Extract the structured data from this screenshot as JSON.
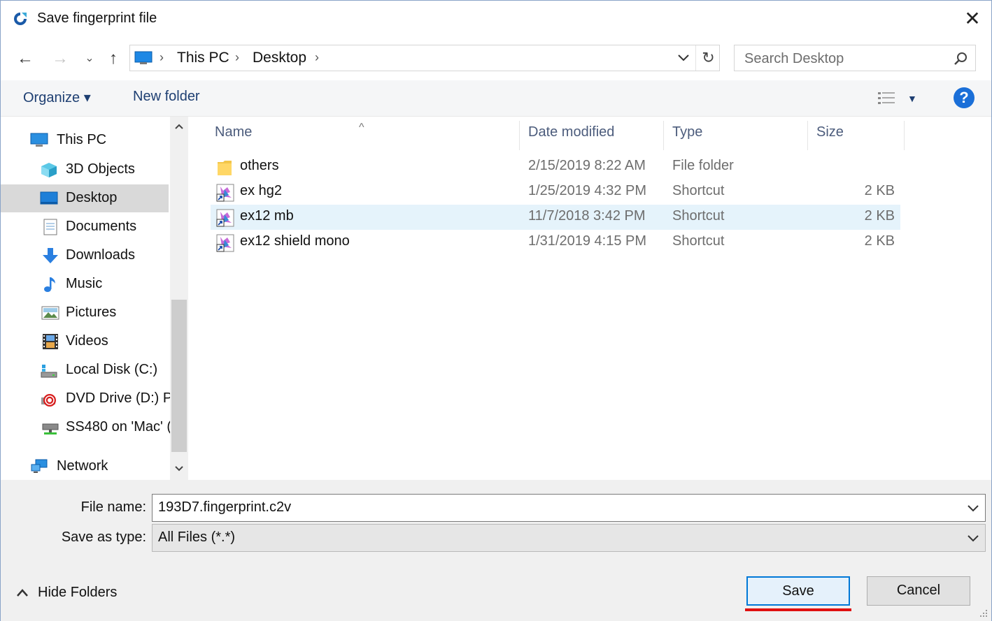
{
  "window": {
    "title": "Save fingerprint file",
    "close_label": "✕"
  },
  "nav": {
    "back_glyph": "←",
    "forward_glyph": "→",
    "recent_glyph": "⌄",
    "up_glyph": "↑",
    "breadcrumb": [
      "This PC",
      "Desktop"
    ],
    "separator": "›",
    "dropdown_glyph": "⌄",
    "refresh_glyph": "↻"
  },
  "search": {
    "placeholder": "Search Desktop"
  },
  "commands": {
    "organize": "Organize ▾",
    "new_folder": "New folder",
    "view_dropdown": "▼",
    "help": "?"
  },
  "sidebar": {
    "items": [
      {
        "label": "This PC",
        "icon": "computer-icon"
      },
      {
        "label": "3D Objects",
        "icon": "cube-icon"
      },
      {
        "label": "Desktop",
        "icon": "desktop-icon",
        "selected": true
      },
      {
        "label": "Documents",
        "icon": "document-icon"
      },
      {
        "label": "Downloads",
        "icon": "download-arrow-icon"
      },
      {
        "label": "Music",
        "icon": "music-note-icon"
      },
      {
        "label": "Pictures",
        "icon": "picture-icon"
      },
      {
        "label": "Videos",
        "icon": "film-icon"
      },
      {
        "label": "Local Disk (C:)",
        "icon": "drive-icon"
      },
      {
        "label": "DVD Drive (D:) P.",
        "icon": "dvd-icon"
      },
      {
        "label": "SS480 on 'Mac' (",
        "icon": "network-drive-icon"
      },
      {
        "label": "Network",
        "icon": "network-icon"
      }
    ],
    "scroll_up": "⌃",
    "scroll_down": "⌄"
  },
  "filelist": {
    "columns": [
      "Name",
      "Date modified",
      "Type",
      "Size"
    ],
    "sort_glyph": "^",
    "rows": [
      {
        "name": "others",
        "date": "2/15/2019 8:22 AM",
        "type": "File folder",
        "size": "",
        "icon": "folder-icon"
      },
      {
        "name": "ex hg2",
        "date": "1/25/2019 4:32 PM",
        "type": "Shortcut",
        "size": "2 KB",
        "icon": "shortcut-icon"
      },
      {
        "name": "ex12 mb",
        "date": "11/7/2018 3:42 PM",
        "type": "Shortcut",
        "size": "2 KB",
        "icon": "shortcut-icon",
        "hover": true
      },
      {
        "name": "ex12 shield mono",
        "date": "1/31/2019 4:15 PM",
        "type": "Shortcut",
        "size": "2 KB",
        "icon": "shortcut-icon"
      }
    ]
  },
  "form": {
    "file_name_label": "File name:",
    "file_name_value": "193D7.fingerprint.c2v",
    "save_type_label": "Save as type:",
    "save_type_value": "All Files (*.*)",
    "hide_folders": "Hide Folders",
    "save": "Save",
    "cancel": "Cancel"
  },
  "colors": {
    "accent": "#0078d7",
    "link": "#1e3f72",
    "highlight_underline": "#e01010",
    "selected_bg": "#d9d9d9",
    "hover_bg": "#e5f3fb"
  }
}
